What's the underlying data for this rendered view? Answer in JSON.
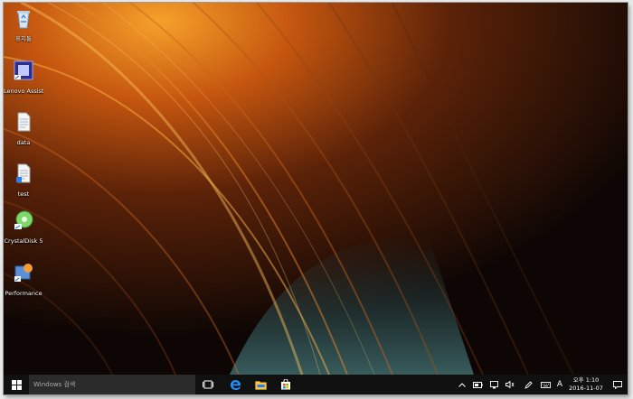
{
  "desktop": {
    "icons": [
      {
        "label": "휴지통",
        "icon": "recycle-bin-icon"
      },
      {
        "label": "Lenovo Assistant",
        "icon": "app-shortcut-icon"
      },
      {
        "label": "data",
        "icon": "text-file-icon"
      },
      {
        "label": "test",
        "icon": "text-file-icon"
      },
      {
        "label": "CrystalDisk 5",
        "icon": "crystaldisk-icon"
      },
      {
        "label": "Performance",
        "icon": "performance-icon"
      }
    ]
  },
  "taskbar": {
    "search_placeholder": "Windows 검색",
    "pinned": [
      "task-view-icon",
      "edge-icon",
      "file-explorer-icon",
      "store-icon"
    ],
    "tray": [
      "chevron-up-icon",
      "battery-icon",
      "network-icon",
      "volume-icon",
      "pen-icon",
      "keyboard-icon"
    ],
    "ime_label": "A",
    "time": "오후 1:10",
    "date": "2016-11-07",
    "accent_color": "#1e90ff"
  }
}
